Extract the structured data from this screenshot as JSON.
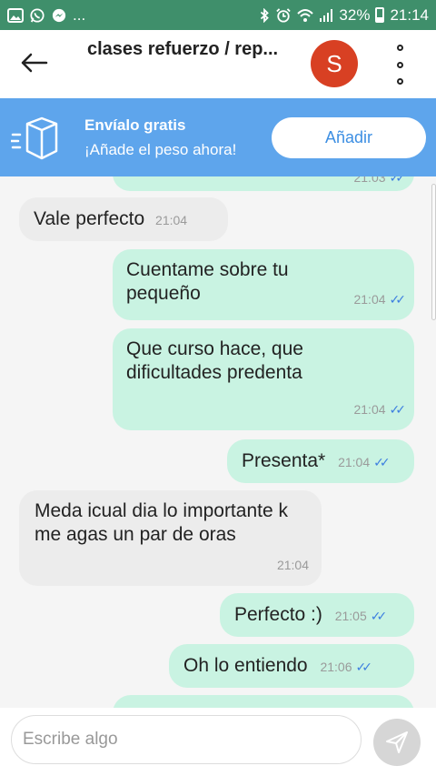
{
  "status_bar": {
    "notif_more": "...",
    "battery": "32%",
    "time": "21:14"
  },
  "header": {
    "title": "clases refuerzo / rep...",
    "avatar_letter": "S"
  },
  "banner": {
    "title": "Envíalo gratis",
    "subtitle": "¡Añade el peso ahora!",
    "button": "Añadir"
  },
  "messages": [
    {
      "dir": "out",
      "text": "",
      "time": "21:03",
      "read": true
    },
    {
      "dir": "in",
      "text": "Vale perfecto",
      "time": "21:04"
    },
    {
      "dir": "out",
      "text": "Cuentame sobre tu pequeño",
      "time": "21:04",
      "read": true
    },
    {
      "dir": "out",
      "text": "Que curso hace, que dificultades predenta",
      "time": "21:04",
      "read": true
    },
    {
      "dir": "out",
      "text": "Presenta*",
      "time": "21:04",
      "read": true
    },
    {
      "dir": "in",
      "text": "Meda icual dia lo importante k me agas un par de oras",
      "time": "21:04"
    },
    {
      "dir": "out",
      "text": "Perfecto :)",
      "time": "21:05",
      "read": true
    },
    {
      "dir": "out",
      "text": "Oh lo entiendo",
      "time": "21:06",
      "read": true
    }
  ],
  "input": {
    "placeholder": "Escribe algo"
  },
  "colors": {
    "status_bar": "#3f8f6b",
    "banner": "#5ea5ec",
    "outgoing_bubble": "#c9f3e2",
    "incoming_bubble": "#ececec",
    "avatar": "#d84023",
    "read_ticks": "#3d7fe0"
  },
  "icons": [
    "gallery-icon",
    "whatsapp-icon",
    "messenger-icon",
    "bluetooth-icon",
    "alarm-icon",
    "wifi-icon",
    "signal-icon",
    "battery-icon",
    "back-arrow-icon",
    "more-vert-icon",
    "package-icon",
    "send-icon",
    "double-check-icon"
  ]
}
